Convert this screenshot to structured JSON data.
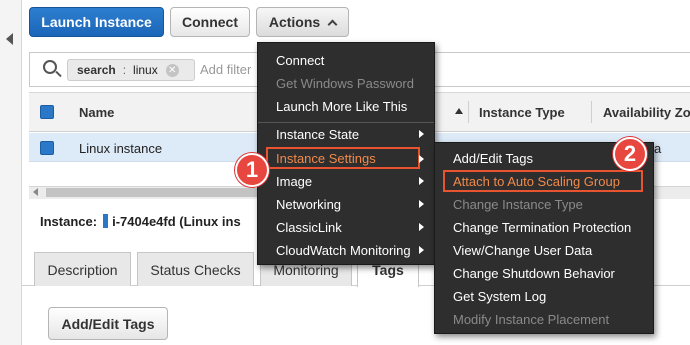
{
  "toolbar": {
    "launch_label": "Launch Instance",
    "connect_label": "Connect",
    "actions_label": "Actions"
  },
  "search": {
    "chip_key": "search",
    "chip_value": "linux",
    "placeholder": "Add filter"
  },
  "table": {
    "columns": [
      "Name",
      "Instance Type",
      "Availability Zo"
    ],
    "rows": [
      {
        "name": "Linux instance",
        "az_fragment": "a"
      }
    ]
  },
  "instance_info": {
    "label": "Instance:",
    "id_text": "i-7404e4fd (Linux ins"
  },
  "tabs": [
    "Description",
    "Status Checks",
    "Monitoring",
    "Tags"
  ],
  "active_tab": "Tags",
  "bottom_button": "Add/Edit Tags",
  "actions_menu": {
    "group1": [
      {
        "label": "Connect",
        "enabled": true
      },
      {
        "label": "Get Windows Password",
        "enabled": false
      },
      {
        "label": "Launch More Like This",
        "enabled": true
      }
    ],
    "group2": [
      {
        "label": "Instance State",
        "submenu": true
      },
      {
        "label": "Instance Settings",
        "submenu": true,
        "highlighted": true
      },
      {
        "label": "Image",
        "submenu": true
      },
      {
        "label": "Networking",
        "submenu": true
      },
      {
        "label": "ClassicLink",
        "submenu": true
      },
      {
        "label": "CloudWatch Monitoring",
        "submenu": true
      }
    ]
  },
  "settings_submenu": [
    {
      "label": "Add/Edit Tags",
      "enabled": true
    },
    {
      "label": "Attach to Auto Scaling Group",
      "enabled": true,
      "highlighted": true
    },
    {
      "label": "Change Instance Type",
      "enabled": false
    },
    {
      "label": "Change Termination Protection",
      "enabled": true
    },
    {
      "label": "View/Change User Data",
      "enabled": true
    },
    {
      "label": "Change Shutdown Behavior",
      "enabled": true
    },
    {
      "label": "Get System Log",
      "enabled": true
    },
    {
      "label": "Modify Instance Placement",
      "enabled": false
    }
  ],
  "callouts": [
    "1",
    "2"
  ],
  "colors": {
    "primary": "#1b66b8",
    "highlight_text": "#f08a4b",
    "highlight_border": "#e8542f",
    "callout": "#e8473f",
    "menu_bg": "#2e2e2e",
    "selected_row": "#ddeaf7"
  },
  "icons": {
    "search": "search-icon",
    "chip_remove": "close-circle-icon",
    "actions_caret": "chevron-up-icon",
    "submenu": "triangle-right-icon",
    "sort": "sort-ascending-icon",
    "collapse": "triangle-left-icon"
  }
}
